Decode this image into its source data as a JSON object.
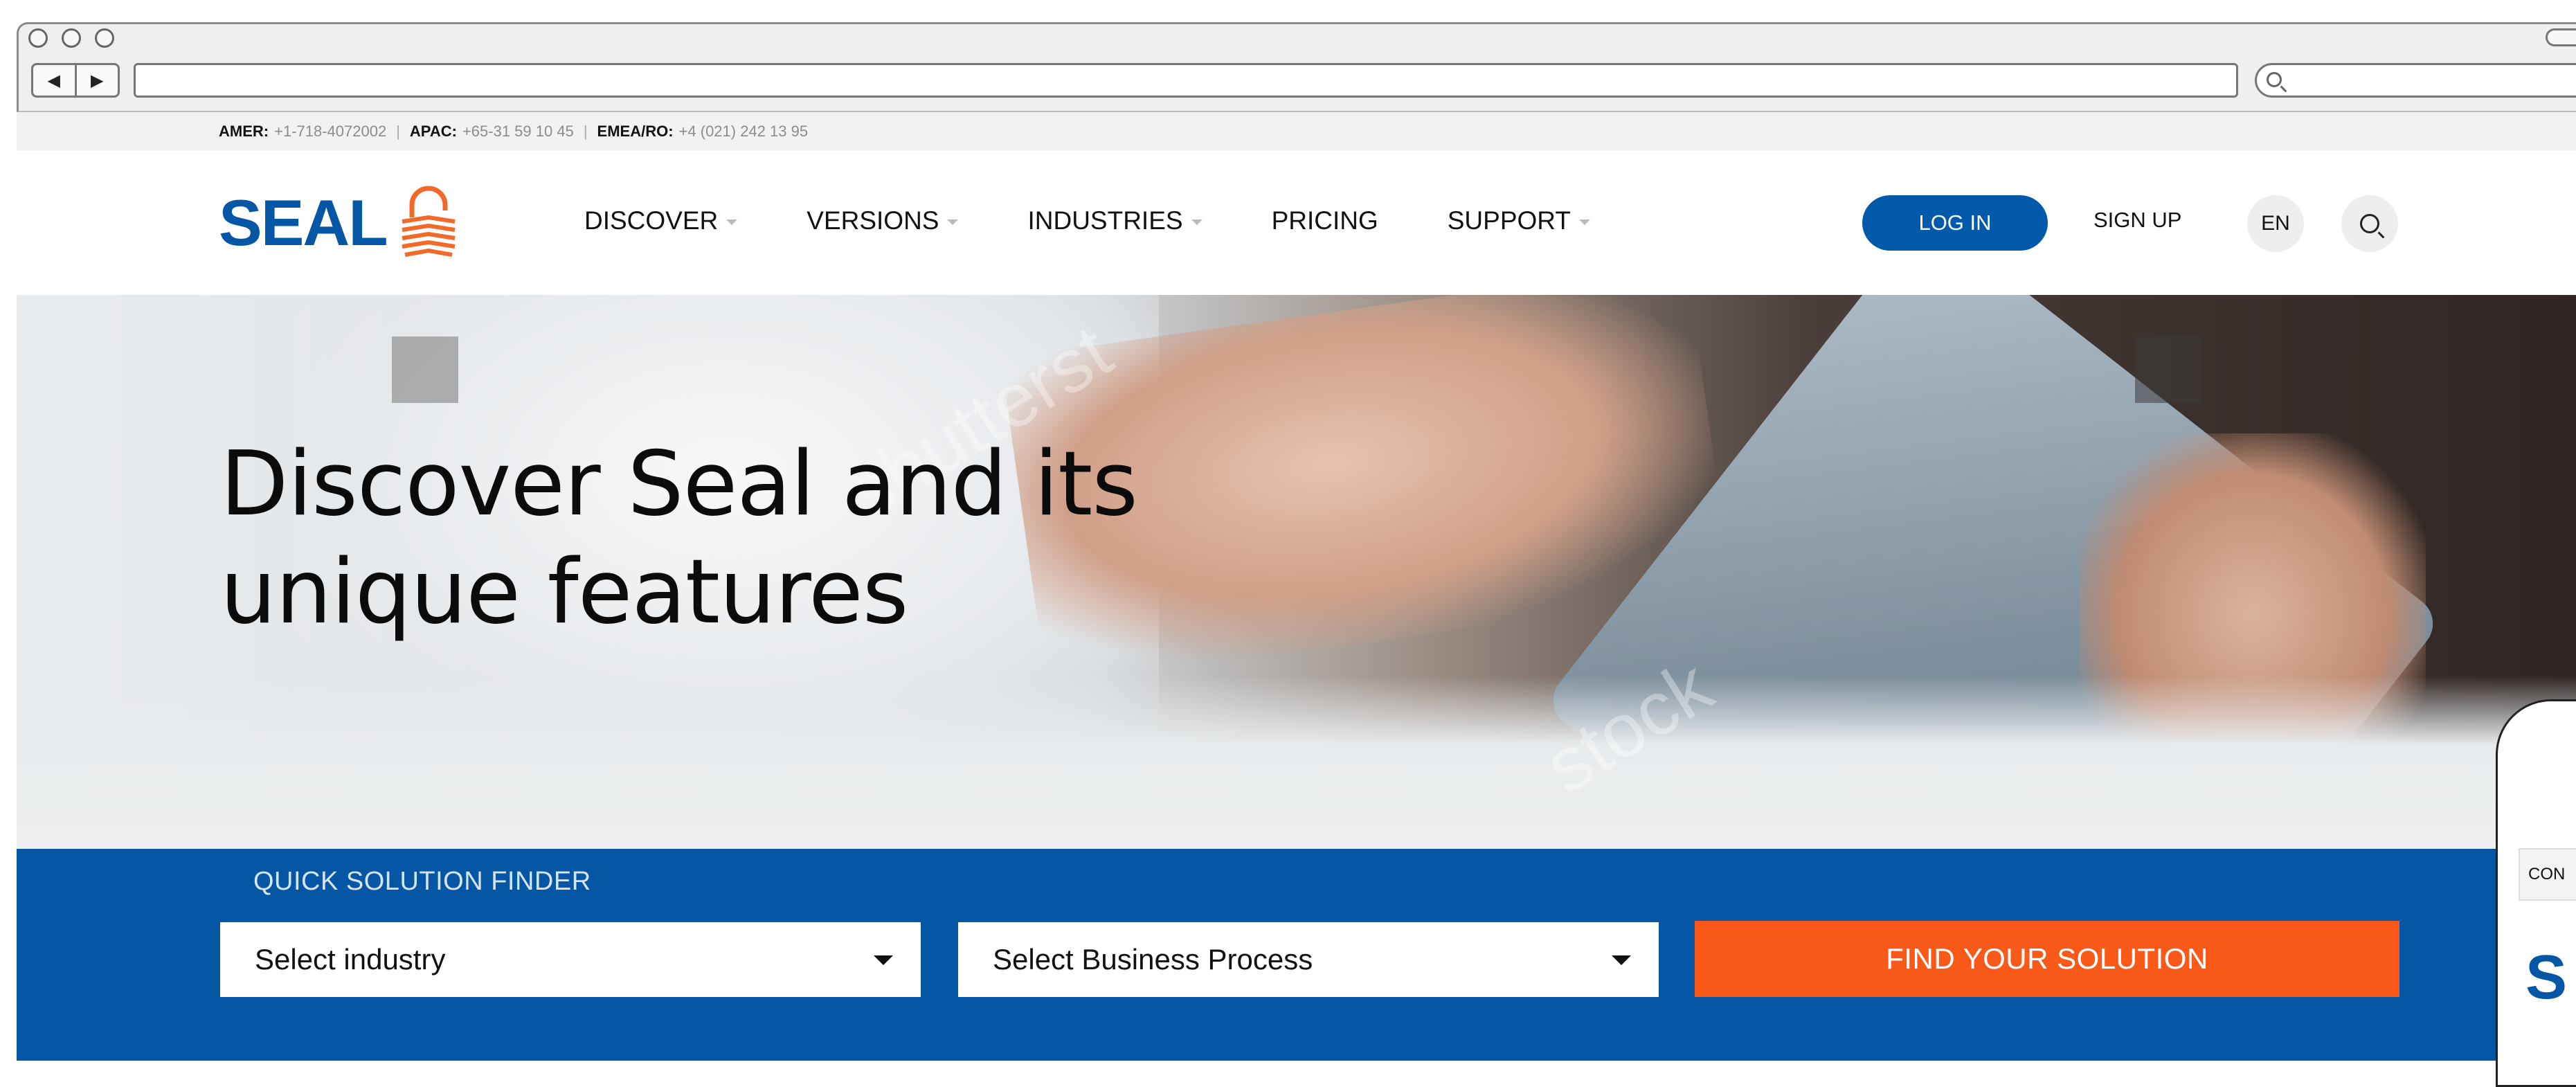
{
  "contact": {
    "amer_label": "AMER:",
    "amer_phone": "+1-718-4072002",
    "apac_label": "APAC:",
    "apac_phone": "+65-31 59 10 45",
    "emea_label": "EMEA/RO:",
    "emea_phone": "+4 (021) 242 13 95",
    "separator": "|"
  },
  "header": {
    "logo_text": "SEAL",
    "nav": [
      "DISCOVER",
      "VERSIONS",
      "INDUSTRIES",
      "PRICING",
      "SUPPORT"
    ],
    "login_label": "LOG IN",
    "signup_label": "SIGN UP",
    "language": "EN"
  },
  "hero": {
    "title": "Discover Seal and its unique features",
    "watermark_1": "shutterst",
    "watermark_2": "stock"
  },
  "finder": {
    "title": "QUICK SOLUTION FINDER",
    "industry_selected": "Select industry",
    "process_selected": "Select Business Process",
    "find_label": "FIND YOUR SOLUTION"
  },
  "side_widget": {
    "tab_text": "CON",
    "letter": "S"
  },
  "colors": {
    "brand_blue": "#0556a5",
    "cta_orange": "#fa5a19",
    "logo_orange": "#f26a2a"
  }
}
